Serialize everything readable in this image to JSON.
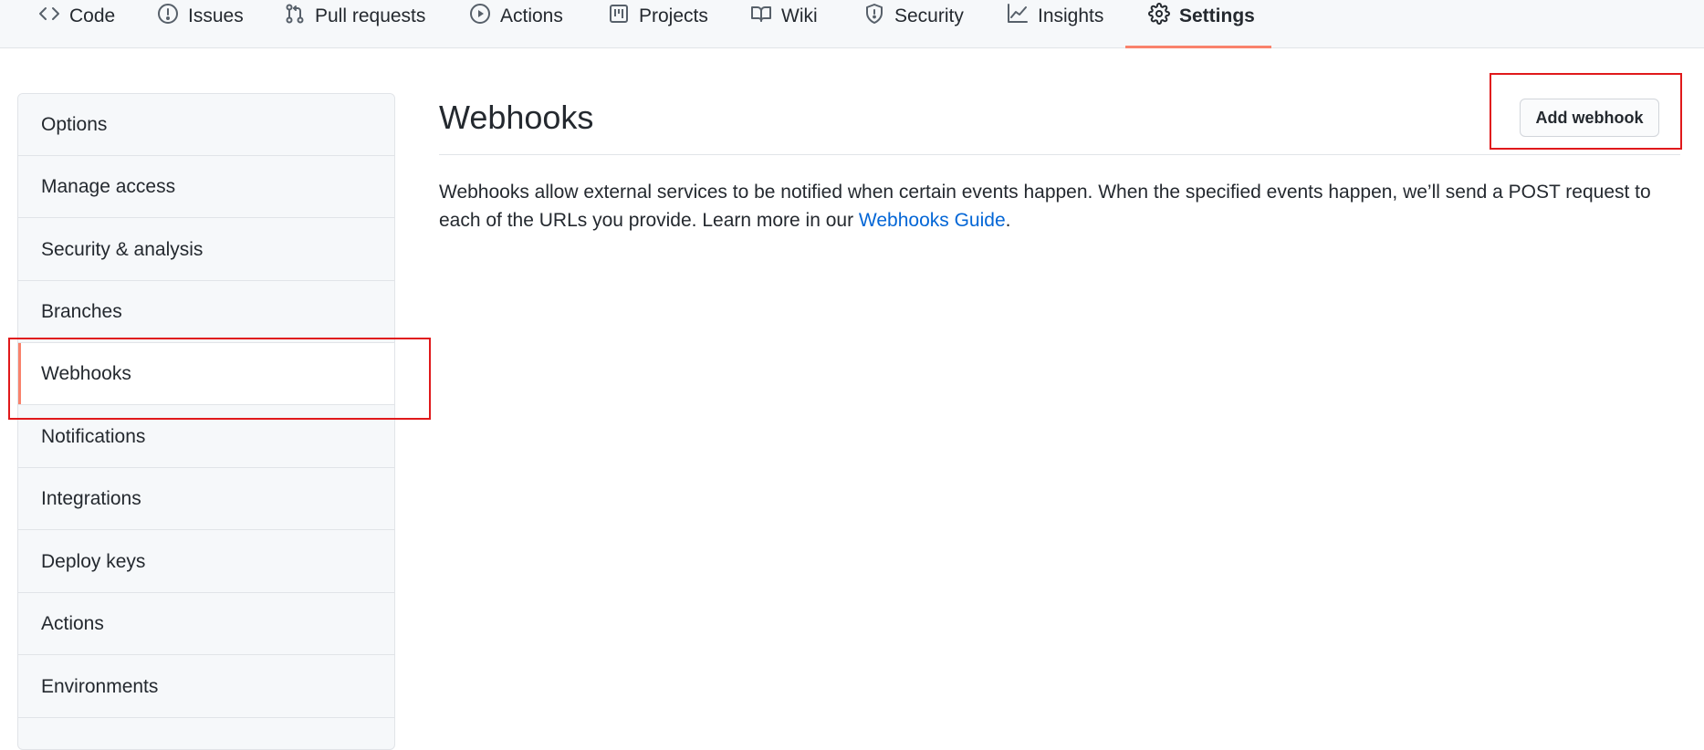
{
  "repo_tabs": [
    {
      "label": "Code",
      "icon": "code-icon"
    },
    {
      "label": "Issues",
      "icon": "issue-opened-icon"
    },
    {
      "label": "Pull requests",
      "icon": "git-pull-request-icon"
    },
    {
      "label": "Actions",
      "icon": "play-icon"
    },
    {
      "label": "Projects",
      "icon": "project-icon"
    },
    {
      "label": "Wiki",
      "icon": "book-icon"
    },
    {
      "label": "Security",
      "icon": "shield-icon"
    },
    {
      "label": "Insights",
      "icon": "graph-icon"
    },
    {
      "label": "Settings",
      "icon": "gear-icon",
      "active": true
    }
  ],
  "sidebar": {
    "items": [
      {
        "label": "Options"
      },
      {
        "label": "Manage access"
      },
      {
        "label": "Security & analysis"
      },
      {
        "label": "Branches"
      },
      {
        "label": "Webhooks",
        "active": true
      },
      {
        "label": "Notifications"
      },
      {
        "label": "Integrations"
      },
      {
        "label": "Deploy keys"
      },
      {
        "label": "Actions"
      },
      {
        "label": "Environments"
      }
    ]
  },
  "main": {
    "title": "Webhooks",
    "description": "Webhooks allow external services to be notified when certain events happen. When the specified events happen, we’ll send a POST request to each of the URLs you provide. Learn more in our ",
    "link_text": "Webhooks Guide",
    "description_end": ".",
    "add_button_label": "Add webhook"
  },
  "colors": {
    "accent_orange": "#f9826c",
    "link_blue": "#0366d6",
    "annotation_red": "#e0191b"
  }
}
